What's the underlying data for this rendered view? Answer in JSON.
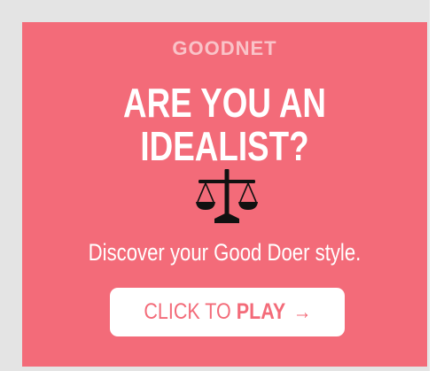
{
  "ad": {
    "brand": "GOODNET",
    "headline_line1": "ARE YOU AN",
    "headline_line2": "IDEALIST?",
    "icon": "scales-of-justice-icon",
    "tagline": "Discover your Good Doer style.",
    "cta": {
      "prefix": "CLICK TO",
      "strong": "PLAY",
      "arrow": "→"
    }
  },
  "colors": {
    "background": "#f36b79",
    "brand_text": "#f9c3c8",
    "text": "#ffffff",
    "icon": "#111111",
    "button_bg": "#ffffff",
    "button_text": "#f36b79",
    "frame": "#e4e4e4"
  }
}
